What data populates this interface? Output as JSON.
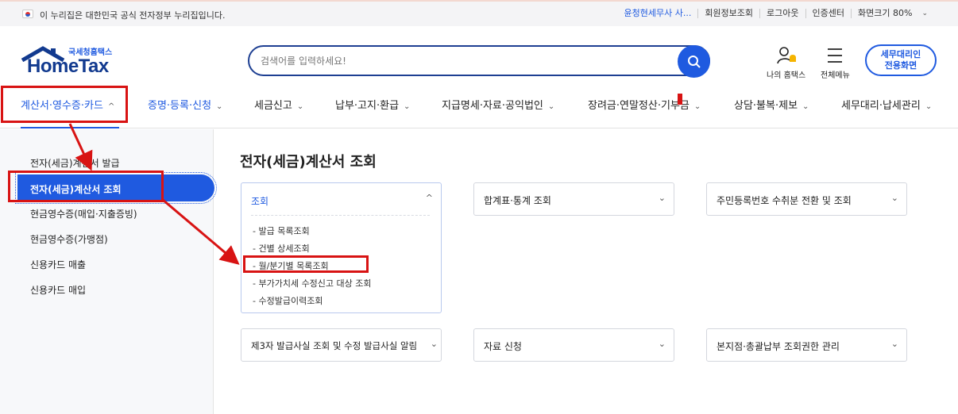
{
  "gov_bar": {
    "notice": "이 누리집은 대한민국 공식 전자정부 누리집입니다.",
    "user": "윤청현세무사 사...",
    "links": [
      "회원정보조회",
      "로그아웃",
      "인증센터",
      "화면크기 80%"
    ]
  },
  "logo": {
    "sub": "국세청홈택스",
    "main": "HomeTax"
  },
  "search": {
    "placeholder": "검색어를 입력하세요!"
  },
  "header": {
    "my_hometax": "나의 홈택스",
    "all_menu": "전체메뉴",
    "agent_line1": "세무대리인",
    "agent_line2": "전용화면"
  },
  "nav": {
    "items": [
      "계산서·영수증·카드",
      "증명·등록·신청",
      "세금신고",
      "납부·고지·환급",
      "지급명세·자료·공익법인",
      "장려금·연말정산·기부금",
      "상담·불복·제보",
      "세무대리·납세관리"
    ]
  },
  "sidebar": {
    "items": [
      "전자(세금)계산서 발급",
      "전자(세금)계산서 조회",
      "현금영수증(매입·지출증빙)",
      "현금영수증(가맹점)",
      "신용카드 매출",
      "신용카드 매입"
    ]
  },
  "main": {
    "title": "전자(세금)계산서 조회",
    "open_card": {
      "title": "조회",
      "items": [
        "발급 목록조회",
        "건별 상세조회",
        "월/분기별 목록조회",
        "부가가치세 수정신고 대상 조회",
        "수정발급이력조회"
      ]
    },
    "cards": [
      "합계표·통계 조회",
      "주민등록번호 수취분 전환 및 조회",
      "제3자 발급사실 조회 및 수정 발급사실 알림",
      "자료 신청",
      "본지점·총괄납부 조회권한 관리"
    ]
  },
  "colors": {
    "accent": "#1f5ae0",
    "navy": "#1d3f92",
    "annotation": "#d81313"
  }
}
